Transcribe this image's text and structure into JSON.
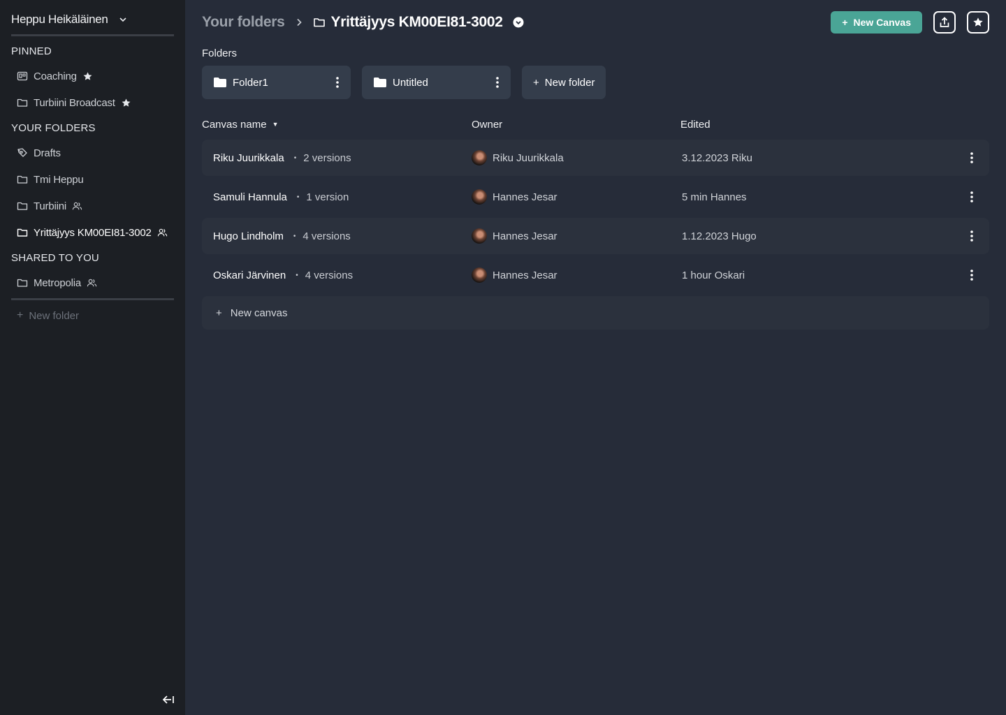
{
  "sidebar": {
    "user_name": "Heppu Heikäläinen",
    "sections": {
      "pinned": "PINNED",
      "your_folders": "YOUR FOLDERS",
      "shared": "SHARED TO YOU"
    },
    "pinned_items": [
      {
        "label": "Coaching",
        "icon": "board-icon",
        "trail": "star-icon"
      },
      {
        "label": "Turbiini Broadcast",
        "icon": "folder-icon",
        "trail": "star-icon"
      }
    ],
    "folder_items": [
      {
        "label": "Drafts",
        "icon": "pen-icon"
      },
      {
        "label": "Tmi Heppu",
        "icon": "folder-icon"
      },
      {
        "label": "Turbiini",
        "icon": "folder-icon",
        "trail": "users-icon"
      },
      {
        "label": "Yrittäjyys KM00EI81-3002",
        "icon": "folder-icon",
        "trail": "users-icon",
        "active": true
      }
    ],
    "shared_items": [
      {
        "label": "Metropolia",
        "icon": "folder-icon",
        "trail": "users-icon"
      }
    ],
    "new_folder_label": "New folder"
  },
  "header": {
    "breadcrumb_root": "Your folders",
    "breadcrumb_current": "Yrittäjyys KM00EI81-3002",
    "new_canvas_label": "New Canvas"
  },
  "folders": {
    "label": "Folders",
    "items": [
      {
        "name": "Folder1"
      },
      {
        "name": "Untitled"
      }
    ],
    "new_folder_label": "New folder"
  },
  "table": {
    "columns": {
      "name": "Canvas name",
      "owner": "Owner",
      "edited": "Edited"
    },
    "rows": [
      {
        "name": "Riku Juurikkala",
        "versions": "2 versions",
        "owner": "Riku Juurikkala",
        "edited": "3.12.2023 Riku"
      },
      {
        "name": "Samuli Hannula",
        "versions": "1 version",
        "owner": "Hannes Jesar",
        "edited": "5 min Hannes"
      },
      {
        "name": "Hugo Lindholm",
        "versions": "4 versions",
        "owner": "Hannes Jesar",
        "edited": "1.12.2023 Hugo"
      },
      {
        "name": "Oskari Järvinen",
        "versions": "4 versions",
        "owner": "Hannes Jesar",
        "edited": "1 hour Oskari"
      }
    ],
    "new_canvas_label": "New canvas"
  },
  "colors": {
    "accent": "#4aa596",
    "sidebar_bg": "#1c1f24",
    "main_bg": "#262c39",
    "card_bg": "#343d4b"
  }
}
